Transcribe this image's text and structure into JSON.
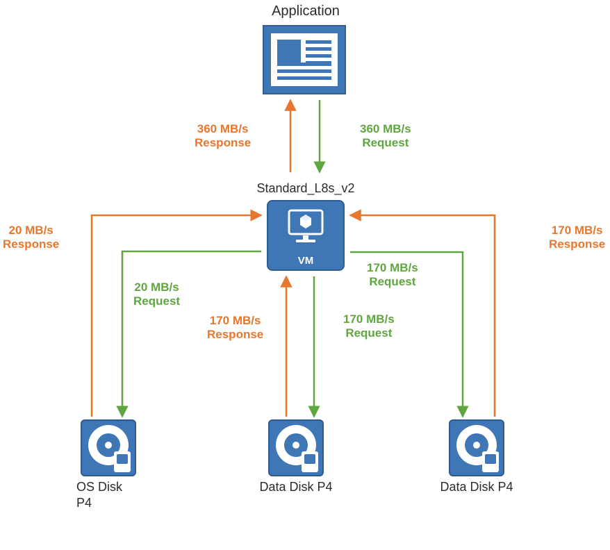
{
  "title_application": "Application",
  "title_vm": "Standard_L8s_v2",
  "vm_box_label": "VM",
  "app_vm_response": "360 MB/s\nResponse",
  "app_vm_request": "360 MB/s\nRequest",
  "os_disk_response": "20 MB/s\nResponse",
  "os_disk_request": "20 MB/s\nRequest",
  "data_disk1_response": "170 MB/s\nResponse",
  "data_disk1_request": "170 MB/s\nRequest",
  "data_disk2_response": "170 MB/s\nResponse",
  "data_disk2_request": "170 MB/s\nRequest",
  "os_disk_label": "OS Disk\nP4",
  "data_disk1_label": "Data Disk\nP4",
  "data_disk2_label": "Data Disk\nP4",
  "colors": {
    "node": "#3e76b6",
    "request": "#5fa641",
    "response": "#e8762d"
  }
}
